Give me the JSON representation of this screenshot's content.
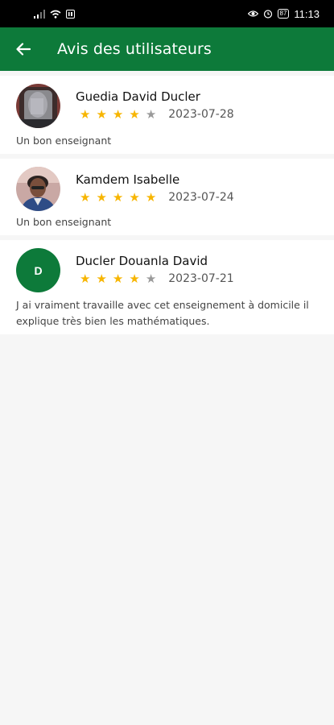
{
  "status_bar": {
    "time": "11:13",
    "battery": "87",
    "icons": [
      "signal-icon",
      "wifi-icon",
      "app-notification-icon",
      "eye-icon",
      "alarm-icon",
      "battery-icon"
    ]
  },
  "app_bar": {
    "title": "Avis des utilisateurs",
    "back_icon": "arrow-left-icon",
    "background": "#0d7a3a"
  },
  "reviews": [
    {
      "name": "Guedia David Ducler",
      "rating": 4,
      "max_rating": 5,
      "date": "2023-07-28",
      "text": "Un bon enseignant",
      "avatar": "photo"
    },
    {
      "name": "Kamdem Isabelle",
      "rating": 5,
      "max_rating": 5,
      "date": "2023-07-24",
      "text": "Un bon enseignant",
      "avatar": "photo"
    },
    {
      "name": "Ducler Douanla David",
      "rating": 4,
      "max_rating": 5,
      "date": "2023-07-21",
      "text": "J ai vraiment travaille avec cet enseignement à domicile il explique très bien les mathématiques.",
      "avatar": "letter",
      "avatar_letter": "D"
    }
  ],
  "colors": {
    "accent": "#0d7a3a",
    "star_filled": "#f7b500",
    "star_empty": "#9a9a9a"
  }
}
